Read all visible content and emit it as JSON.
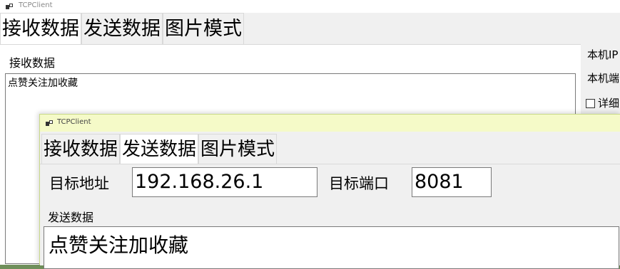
{
  "back_window": {
    "title": "TCPClient",
    "tabs": [
      {
        "label": "接收数据",
        "selected": true
      },
      {
        "label": "发送数据",
        "selected": false
      },
      {
        "label": "图片模式",
        "selected": false
      }
    ],
    "receive_group_label": "接收数据",
    "receive_text": "点赞关注加收藏",
    "side": {
      "local_ip_label": "本机IP",
      "local_port_label": "本机端",
      "detail_checkbox_label": "详细",
      "detail_checked": false
    }
  },
  "front_window": {
    "title": "TCPClient",
    "tabs": [
      {
        "label": "接收数据",
        "selected": false
      },
      {
        "label": "发送数据",
        "selected": true
      },
      {
        "label": "图片模式",
        "selected": false
      }
    ],
    "target_address_label": "目标地址",
    "target_address_value": "192.168.26.1",
    "target_port_label": "目标端口",
    "target_port_value": "8081",
    "send_group_label": "发送数据",
    "send_text": "点赞关注加收藏"
  }
}
